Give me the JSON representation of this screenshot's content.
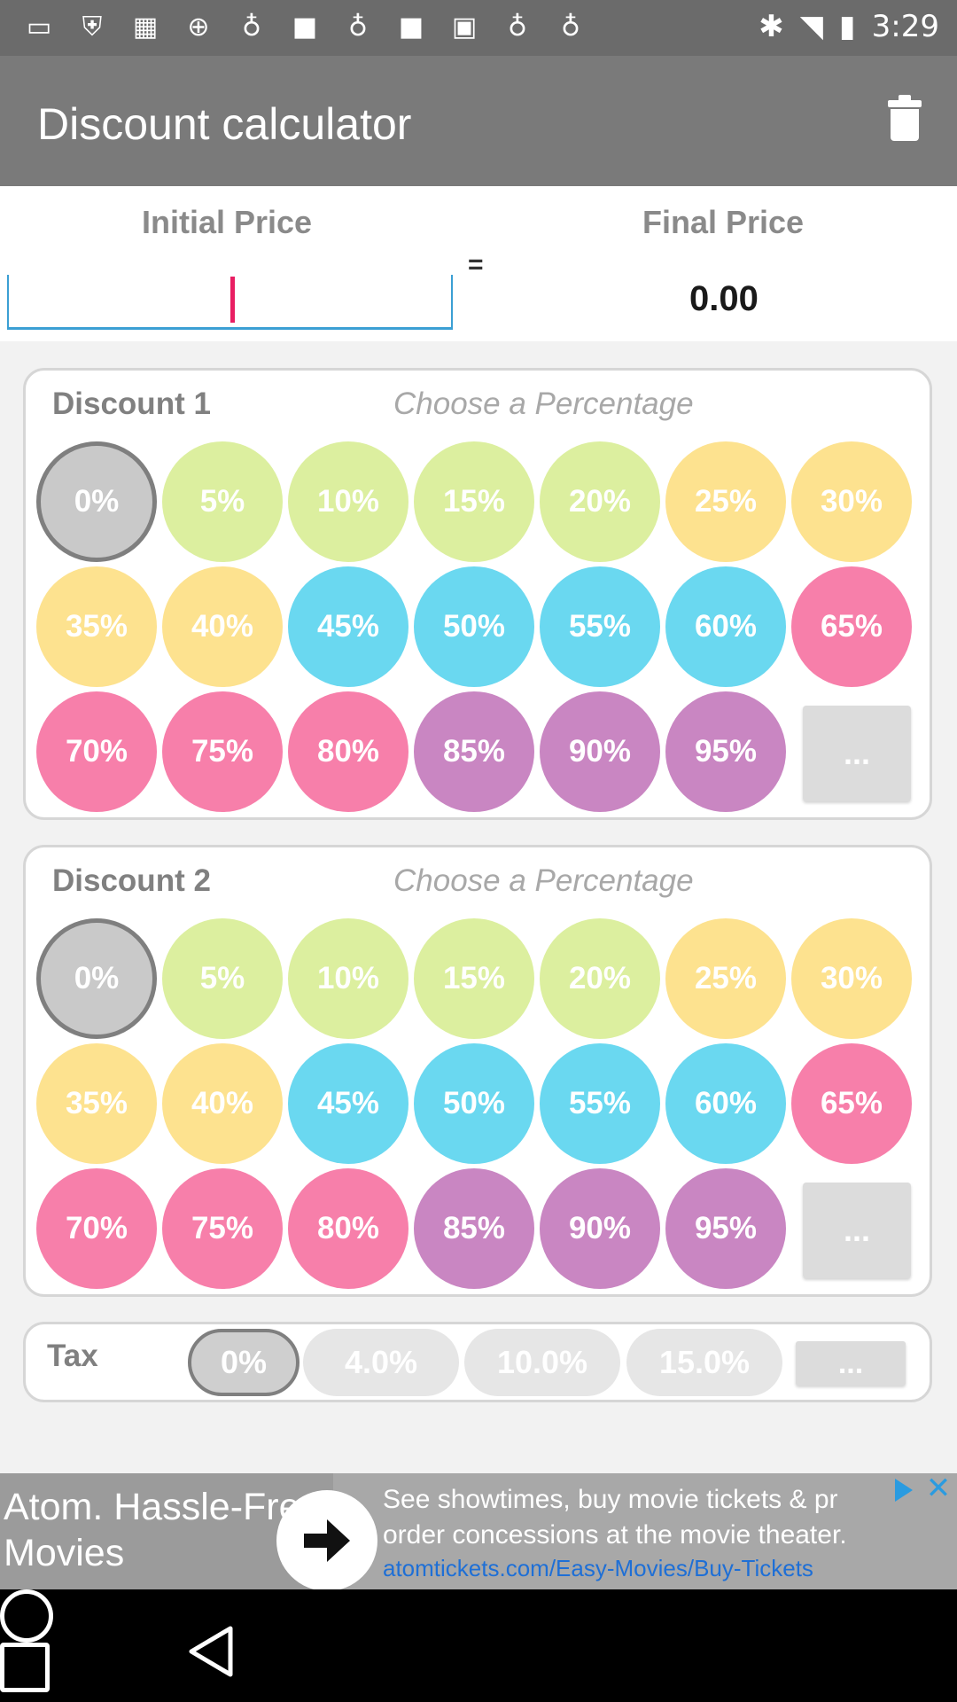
{
  "status_bar": {
    "time": "3:29",
    "left_icons": [
      "chat-icon",
      "shield-icon",
      "calculator-icon",
      "download-icon",
      "bulb-icon",
      "square-icon",
      "bulb-icon",
      "square-icon",
      "robot-icon",
      "bulb-icon",
      "bulb-icon"
    ],
    "right_icons": [
      "bluetooth-icon",
      "wifi-icon",
      "battery-icon"
    ]
  },
  "appbar": {
    "title": "Discount calculator",
    "action_icon": "trash-icon"
  },
  "price_panel": {
    "initial_label": "Initial Price",
    "equals": "=",
    "initial_value": "",
    "final_label": "Final Price",
    "final_value": "0.00"
  },
  "discount_cards": [
    {
      "heading": "Discount 1",
      "hint": "Choose a Percentage",
      "options": [
        "0%",
        "5%",
        "10%",
        "15%",
        "20%",
        "25%",
        "30%",
        "35%",
        "40%",
        "45%",
        "50%",
        "55%",
        "60%",
        "65%",
        "70%",
        "75%",
        "80%",
        "85%",
        "90%",
        "95%"
      ],
      "selected": "0%",
      "more_label": "..."
    },
    {
      "heading": "Discount 2",
      "hint": "Choose a Percentage",
      "options": [
        "0%",
        "5%",
        "10%",
        "15%",
        "20%",
        "25%",
        "30%",
        "35%",
        "40%",
        "45%",
        "50%",
        "55%",
        "60%",
        "65%",
        "70%",
        "75%",
        "80%",
        "85%",
        "90%",
        "95%"
      ],
      "selected": "0%",
      "more_label": "..."
    }
  ],
  "tax": {
    "label": "Tax",
    "options": [
      "0%",
      "4.0%",
      "10.0%",
      "15.0%"
    ],
    "selected": "0%",
    "more_label": "..."
  },
  "colors": {
    "grey": "#c9c9c9",
    "green": "#dcef9f",
    "yellow": "#fde28f",
    "blue": "#6ad8f0",
    "pink": "#f77faa",
    "purple": "#c986c2"
  },
  "option_color_keys": [
    "grey",
    "green",
    "green",
    "green",
    "green",
    "yellow",
    "yellow",
    "yellow",
    "yellow",
    "blue",
    "blue",
    "blue",
    "blue",
    "pink",
    "pink",
    "pink",
    "pink",
    "purple",
    "purple",
    "purple"
  ],
  "ad": {
    "headline": "Atom. Hassle-Free Movies",
    "body": "See showtimes, buy movie tickets & pr order concessions at the movie theater.",
    "link": "atomtickets.com/Easy-Movies/Buy-Tickets"
  },
  "navbar": {
    "buttons": [
      "back-icon",
      "home-icon",
      "recents-icon"
    ]
  }
}
